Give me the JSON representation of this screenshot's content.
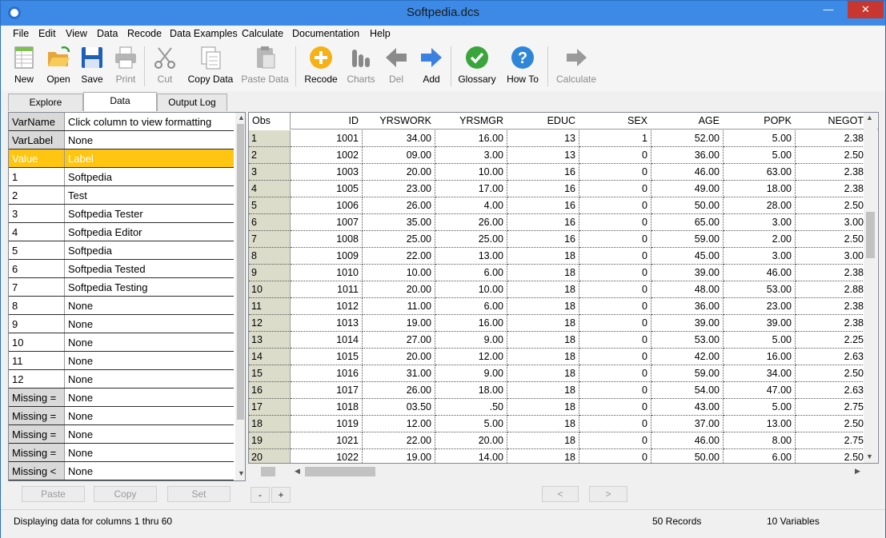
{
  "window": {
    "title": "Softpedia.dcs"
  },
  "menu": [
    "File",
    "Edit",
    "View",
    "Data",
    "Recode",
    "Data Examples",
    "Calculate",
    "Documentation",
    "Help"
  ],
  "toolbar": [
    {
      "label": "New",
      "icon": "new-sheet-icon",
      "enabled": true
    },
    {
      "label": "Open",
      "icon": "folder-open-icon",
      "enabled": true
    },
    {
      "label": "Save",
      "icon": "floppy-disk-icon",
      "enabled": true
    },
    {
      "label": "Print",
      "icon": "printer-icon",
      "enabled": false
    },
    {
      "label": "Cut",
      "icon": "scissors-icon",
      "enabled": false
    },
    {
      "label": "Copy Data",
      "icon": "copy-icon",
      "enabled": true
    },
    {
      "label": "Paste Data",
      "icon": "paste-icon",
      "enabled": false
    },
    {
      "label": "Recode",
      "icon": "plus-circle-icon",
      "enabled": true
    },
    {
      "label": "Charts",
      "icon": "bar-chart-icon",
      "enabled": false
    },
    {
      "label": "Del",
      "icon": "arrow-left-icon",
      "enabled": false
    },
    {
      "label": "Add",
      "icon": "arrow-right-icon",
      "enabled": true
    },
    {
      "label": "Glossary",
      "icon": "check-circle-icon",
      "enabled": true
    },
    {
      "label": "How To",
      "icon": "question-circle-icon",
      "enabled": true
    },
    {
      "label": "Calculate",
      "icon": "arrow-right-gray-icon",
      "enabled": false
    }
  ],
  "tabs": [
    "Explore",
    "Data",
    "Output Log"
  ],
  "left_panel": {
    "header_rows": [
      [
        "VarName",
        "Click column to view formatting"
      ],
      [
        "VarLabel",
        "None"
      ]
    ],
    "selected_row": [
      "Value",
      "Label"
    ],
    "value_rows": [
      [
        "1",
        "Softpedia"
      ],
      [
        "2",
        "Test"
      ],
      [
        "3",
        "Softpedia Tester"
      ],
      [
        "4",
        "Softpedia Editor"
      ],
      [
        "5",
        "Softpedia"
      ],
      [
        "6",
        "Softpedia Tested"
      ],
      [
        "7",
        "Softpedia Testing"
      ],
      [
        "8",
        "None"
      ],
      [
        "9",
        "None"
      ],
      [
        "10",
        "None"
      ],
      [
        "11",
        "None"
      ],
      [
        "12",
        "None"
      ]
    ],
    "missing_rows": [
      [
        "Missing =",
        "None"
      ],
      [
        "Missing =",
        "None"
      ],
      [
        "Missing =",
        "None"
      ],
      [
        "Missing =",
        "None"
      ],
      [
        "Missing <",
        "None"
      ]
    ],
    "buttons": [
      "Paste",
      "Copy",
      "Set"
    ]
  },
  "grid": {
    "columns": [
      "Obs",
      "ID",
      "YRSWORK",
      "YRSMGR",
      "EDUC",
      "SEX",
      "AGE",
      "POPK",
      "NEGOT"
    ],
    "rows": [
      [
        "1",
        "1001",
        "34.00",
        "16.00",
        "13",
        "1",
        "52.00",
        "5.00",
        "2.38"
      ],
      [
        "2",
        "1002",
        "09.00",
        "3.00",
        "13",
        "0",
        "36.00",
        "5.00",
        "2.50"
      ],
      [
        "3",
        "1003",
        "20.00",
        "10.00",
        "16",
        "0",
        "46.00",
        "63.00",
        "2.38"
      ],
      [
        "4",
        "1005",
        "23.00",
        "17.00",
        "16",
        "0",
        "49.00",
        "18.00",
        "2.38"
      ],
      [
        "5",
        "1006",
        "26.00",
        "4.00",
        "16",
        "0",
        "50.00",
        "28.00",
        "2.50"
      ],
      [
        "6",
        "1007",
        "35.00",
        "26.00",
        "16",
        "0",
        "65.00",
        "3.00",
        "3.00"
      ],
      [
        "7",
        "1008",
        "25.00",
        "25.00",
        "16",
        "0",
        "59.00",
        "2.00",
        "2.50"
      ],
      [
        "8",
        "1009",
        "22.00",
        "13.00",
        "18",
        "0",
        "45.00",
        "3.00",
        "3.00"
      ],
      [
        "9",
        "1010",
        "10.00",
        "6.00",
        "18",
        "0",
        "39.00",
        "46.00",
        "2.38"
      ],
      [
        "10",
        "1011",
        "20.00",
        "10.00",
        "18",
        "0",
        "48.00",
        "53.00",
        "2.88"
      ],
      [
        "11",
        "1012",
        "11.00",
        "6.00",
        "18",
        "0",
        "36.00",
        "23.00",
        "2.38"
      ],
      [
        "12",
        "1013",
        "19.00",
        "16.00",
        "18",
        "0",
        "39.00",
        "39.00",
        "2.38"
      ],
      [
        "13",
        "1014",
        "27.00",
        "9.00",
        "18",
        "0",
        "53.00",
        "5.00",
        "2.25"
      ],
      [
        "14",
        "1015",
        "20.00",
        "12.00",
        "18",
        "0",
        "42.00",
        "16.00",
        "2.63"
      ],
      [
        "15",
        "1016",
        "31.00",
        "9.00",
        "18",
        "0",
        "59.00",
        "34.00",
        "2.50"
      ],
      [
        "16",
        "1017",
        "26.00",
        "18.00",
        "18",
        "0",
        "54.00",
        "47.00",
        "2.63"
      ],
      [
        "17",
        "1018",
        "03.50",
        ".50",
        "18",
        "0",
        "43.00",
        "5.00",
        "2.75"
      ],
      [
        "18",
        "1019",
        "12.00",
        "5.00",
        "18",
        "0",
        "37.00",
        "13.00",
        "2.50"
      ],
      [
        "19",
        "1021",
        "22.00",
        "20.00",
        "18",
        "0",
        "46.00",
        "8.00",
        "2.75"
      ],
      [
        "20",
        "1022",
        "19.00",
        "14.00",
        "18",
        "0",
        "50.00",
        "6.00",
        "2.50"
      ]
    ],
    "zoom_buttons": [
      "-",
      "+"
    ],
    "nav_buttons": [
      "<",
      ">"
    ]
  },
  "status": {
    "left": "Displaying data for columns 1 thru 60",
    "records": "50 Records",
    "variables": "10 Variables"
  },
  "colors": {
    "titlebar": "#3c8ae6",
    "selected_row": "#ffc511",
    "obs_column": "#dcdccb"
  }
}
